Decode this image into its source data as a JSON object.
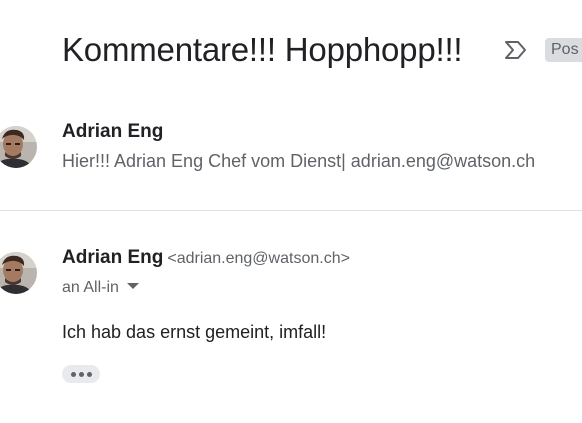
{
  "thread": {
    "subject": "Kommentare!!! Hopphopp!!!",
    "label_icon": "label-arrow-icon",
    "label_chip": "Pos"
  },
  "messages": [
    {
      "sender_name": "Adrian Eng",
      "snippet": "Hier!!! Adrian Eng Chef vom Dienst| adrian.eng@watson.ch",
      "collapsed": true
    },
    {
      "sender_name": "Adrian Eng",
      "sender_email": "<adrian.eng@watson.ch>",
      "recipients": "an All-in",
      "body": "Ich hab das ernst gemeint, imfall!",
      "show_trimmed_icon": "more-horiz-icon",
      "collapsed": false
    }
  ],
  "colors": {
    "text_primary": "#202124",
    "text_secondary": "#5f6368",
    "chip_background": "#dadce0",
    "divider": "#e0e0e0"
  }
}
